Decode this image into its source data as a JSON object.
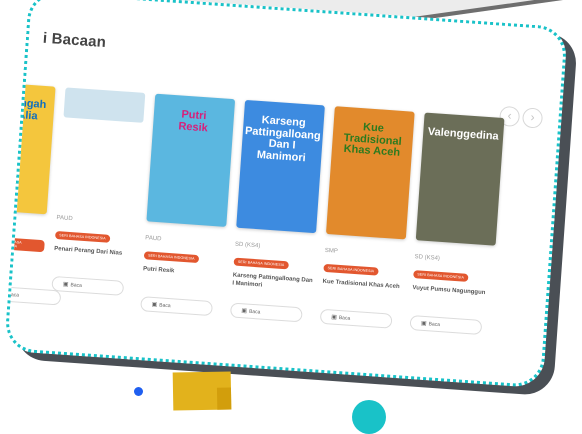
{
  "section": {
    "title": "i Bacaan"
  },
  "nav": {
    "prev_icon": "chevron-left-icon",
    "next_icon": "chevron-right-icon",
    "prev": "‹",
    "next": "›"
  },
  "read_label": "Baca",
  "colors": {
    "frame_border": "#19c2c8",
    "tag_bg": "#e2572f",
    "accent_yellow": "#e2b21c",
    "accent_blue": "#1f5ff0"
  },
  "books": [
    {
      "cover_text": "tengah\nAlia",
      "level": "",
      "tag": "SERI BAHASA INDONESIA",
      "title": "...",
      "cover_bg": "#f4c63d",
      "cover_fg": "#0f6fbf"
    },
    {
      "cover_text": "",
      "level": "PAUD",
      "tag": "SERI BAHASA INDONESIA",
      "title": "Penari Perang Dari Nias",
      "cover_bg": "#cfe3ee",
      "cover_fg": "#333333"
    },
    {
      "cover_text": "Putri\nResik",
      "level": "PAUD",
      "tag": "SERI BAHASA INDONESIA",
      "title": "Putri Resik",
      "cover_bg": "#5bb7e0",
      "cover_fg": "#d81f7a"
    },
    {
      "cover_text": "Karseng Pattingalloang Dan I Manimori",
      "level": "SD (KS4)",
      "tag": "SERI BAHASA INDONESIA",
      "title": "Karseng Pattingalloang Dan I Manimori",
      "cover_bg": "#3d8be0",
      "cover_fg": "#ffffff"
    },
    {
      "cover_text": "Kue Tradisional\nKhas Aceh",
      "level": "SMP",
      "tag": "SERI BAHASA INDONESIA",
      "title": "Kue Tradisional Khas Aceh",
      "cover_bg": "#e28a2c",
      "cover_fg": "#2d7a1f"
    },
    {
      "cover_text": "Valenggedina",
      "level": "SD (KS4)",
      "tag": "SERI BAHASA INDONESIA",
      "title": "Vuyut Pumsu Nagunggun",
      "cover_bg": "#6b6e58",
      "cover_fg": "#ffffff"
    }
  ]
}
